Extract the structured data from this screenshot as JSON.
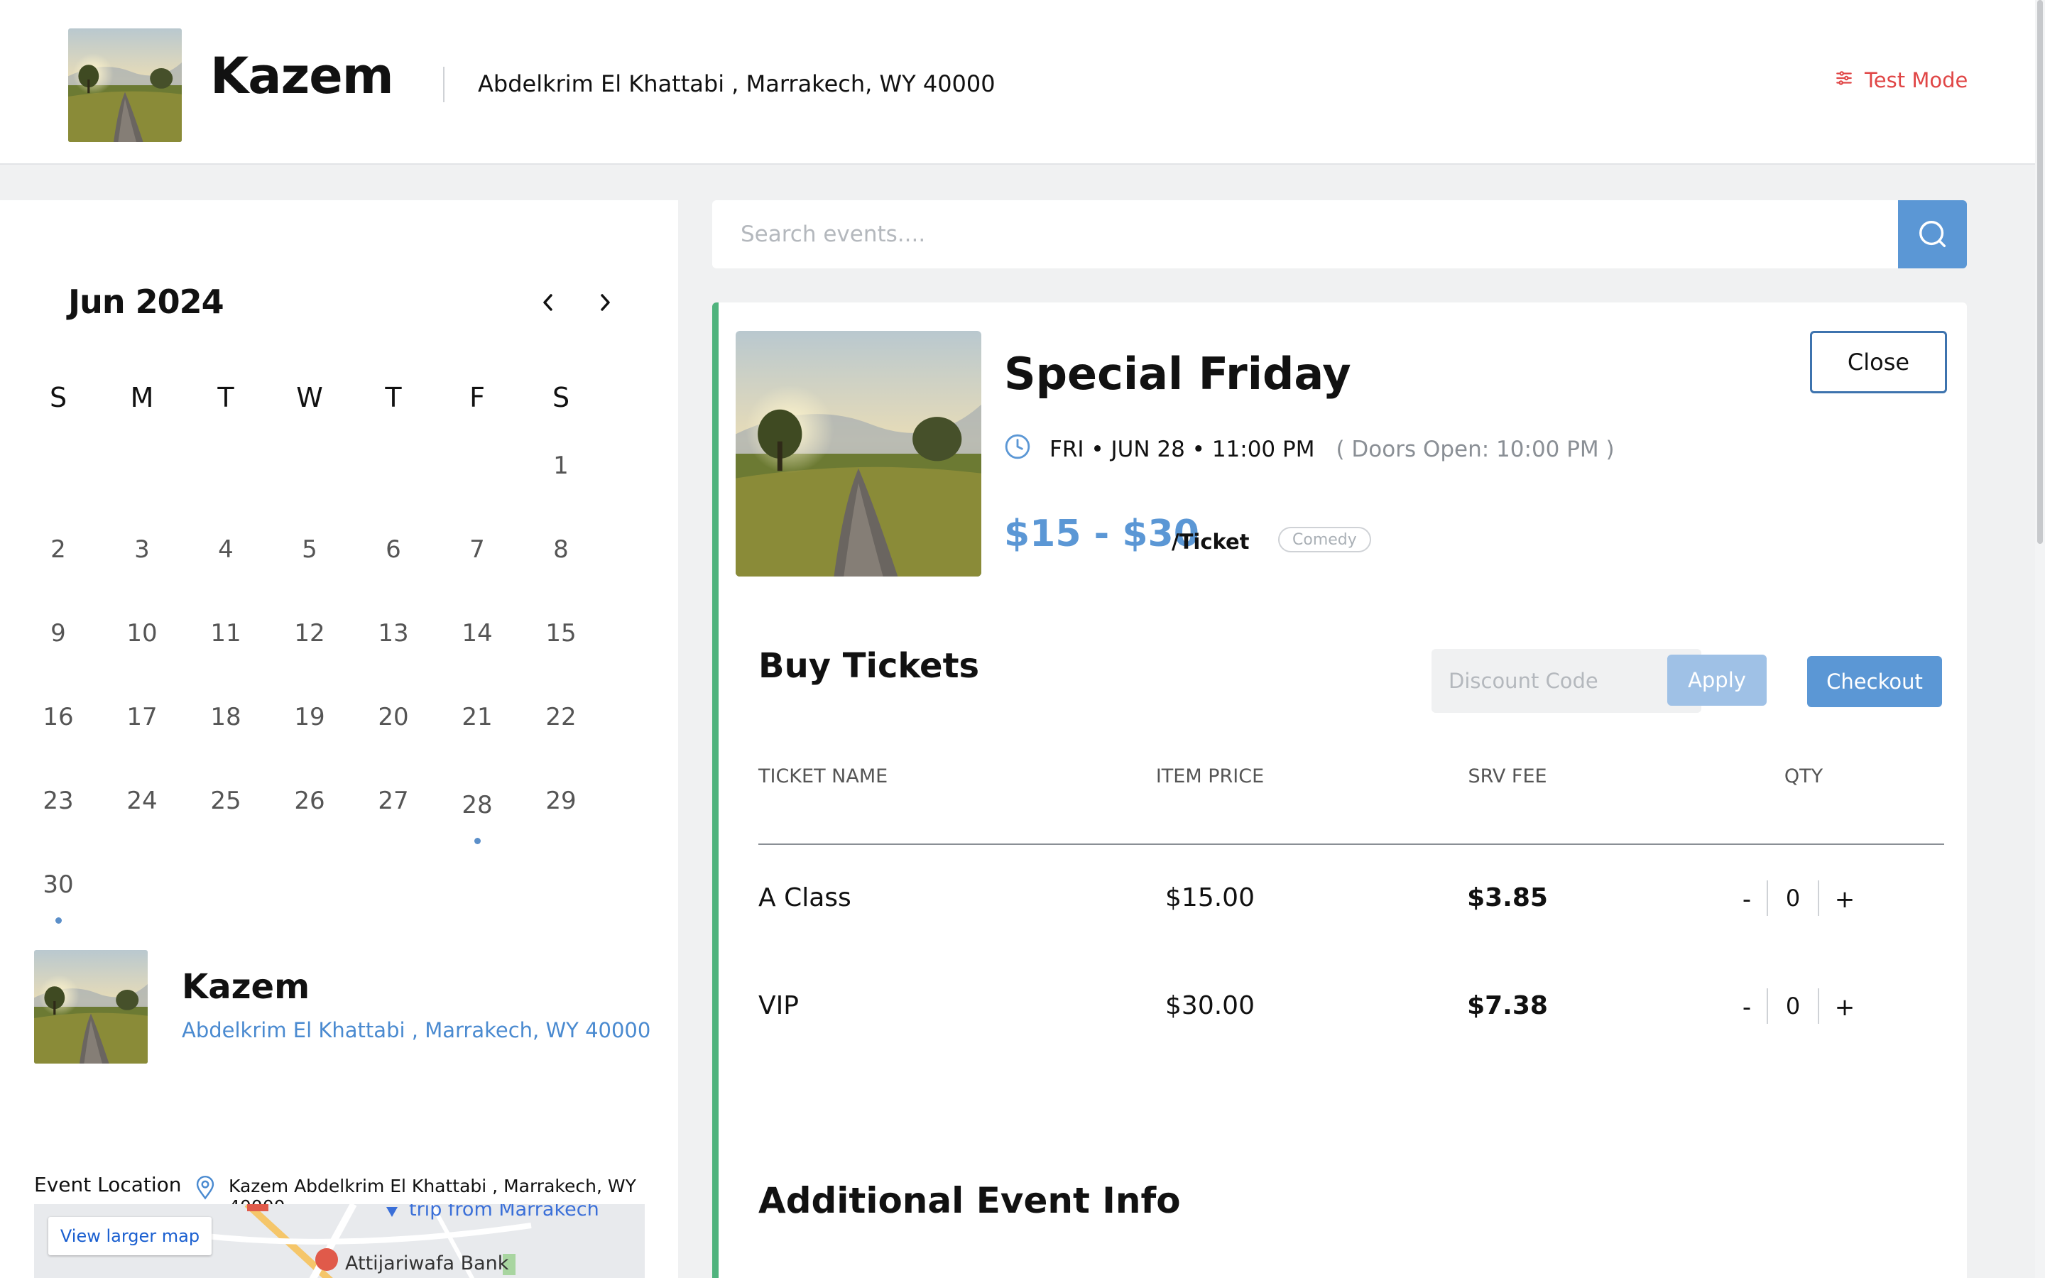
{
  "header": {
    "venue_name": "Kazem",
    "venue_address": "Abdelkrim El Khattabi , Marrakech, WY 40000",
    "test_mode_label": "Test Mode"
  },
  "calendar": {
    "month_label": "Jun 2024",
    "weekdays": [
      "S",
      "M",
      "T",
      "W",
      "T",
      "F",
      "S"
    ],
    "days": [
      "1",
      "2",
      "3",
      "4",
      "5",
      "6",
      "7",
      "8",
      "9",
      "10",
      "11",
      "12",
      "13",
      "14",
      "15",
      "16",
      "17",
      "18",
      "19",
      "20",
      "21",
      "22",
      "23",
      "24",
      "25",
      "26",
      "27",
      "28",
      "29",
      "30"
    ],
    "event_days": [
      "28",
      "30"
    ]
  },
  "organizer": {
    "name": "Kazem",
    "address": "Abdelkrim El Khattabi , Marrakech, WY 40000"
  },
  "location": {
    "label": "Event Location",
    "text": "Kazem Abdelkrim El Khattabi , Marrakech, WY 40000",
    "map_button": "View larger map",
    "map_label_1": "trip from Marrakech",
    "map_label_2": "Attijariwafa Bank"
  },
  "search": {
    "placeholder": "Search events...."
  },
  "event": {
    "title": "Special Friday",
    "date": "FRI • JUN 28 • 11:00 PM",
    "doors": "( Doors Open: 10:00 PM )",
    "price_range": "$15 - $30",
    "price_unit": "/Ticket",
    "category": "Comedy",
    "close_label": "Close"
  },
  "tickets": {
    "title": "Buy Tickets",
    "discount_placeholder": "Discount Code",
    "apply_label": "Apply",
    "checkout_label": "Checkout",
    "columns": [
      "TICKET NAME",
      "ITEM PRICE",
      "SRV FEE",
      "QTY"
    ],
    "rows": [
      {
        "name": "A Class",
        "price": "$15.00",
        "fee": "$3.85",
        "qty": "0"
      },
      {
        "name": "VIP",
        "price": "$30.00",
        "fee": "$7.38",
        "qty": "0"
      }
    ],
    "minus": "-",
    "plus": "+"
  },
  "additional_info_title": "Additional Event Info",
  "colors": {
    "accent": "#5b97d5",
    "link": "#4a8ad0",
    "card_border": "#4fb37d",
    "test_mode": "#e04646"
  },
  "icons": [
    "sliders-icon",
    "chevron-left-icon",
    "chevron-right-icon",
    "search-icon",
    "clock-icon",
    "map-pin-icon"
  ]
}
